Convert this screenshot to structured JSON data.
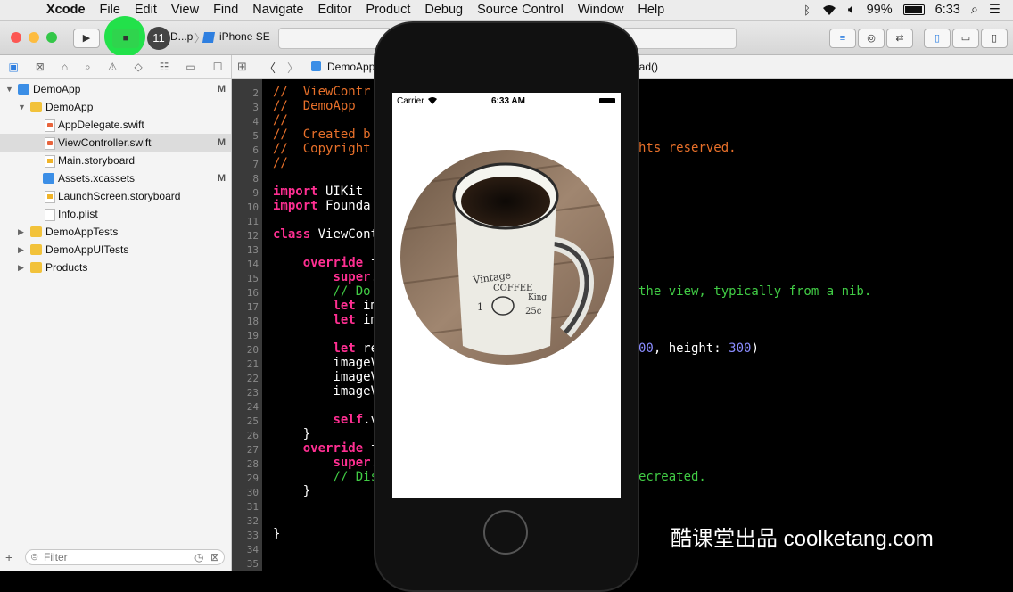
{
  "menubar": {
    "apple": "",
    "app_name": "Xcode",
    "items": [
      "File",
      "Edit",
      "View",
      "Find",
      "Navigate",
      "Editor",
      "Product",
      "Debug",
      "Source Control",
      "Window",
      "Help"
    ],
    "battery": "99%",
    "time": "6:33"
  },
  "toolbar": {
    "badge": "11",
    "scheme": "D...p",
    "device": "iPhone SE"
  },
  "navigator": {
    "rows": [
      {
        "label": "DemoApp",
        "type": "project",
        "m": "M"
      },
      {
        "label": "DemoApp",
        "type": "folder",
        "m": ""
      },
      {
        "label": "AppDelegate.swift",
        "type": "swift",
        "m": ""
      },
      {
        "label": "ViewController.swift",
        "type": "swift",
        "m": "M"
      },
      {
        "label": "Main.storyboard",
        "type": "storyboard",
        "m": ""
      },
      {
        "label": "Assets.xcassets",
        "type": "assets",
        "m": "M"
      },
      {
        "label": "LaunchScreen.storyboard",
        "type": "storyboard",
        "m": ""
      },
      {
        "label": "Info.plist",
        "type": "plist",
        "m": ""
      },
      {
        "label": "DemoAppTests",
        "type": "folder",
        "m": ""
      },
      {
        "label": "DemoAppUITests",
        "type": "folder",
        "m": ""
      },
      {
        "label": "Products",
        "type": "folder",
        "m": ""
      }
    ],
    "filter_placeholder": "Filter"
  },
  "jumpbar": {
    "file": "DemoApp",
    "symbol": "oad()"
  },
  "editor": {
    "lines": [
      {
        "n": "2",
        "t": "//  ViewContr",
        "c": "cmt"
      },
      {
        "n": "3",
        "t": "//  DemoApp",
        "c": "cmt"
      },
      {
        "n": "4",
        "t": "//",
        "c": "cmt"
      },
      {
        "n": "5",
        "t": "//  Created b",
        "c": "cmt"
      },
      {
        "n": "6",
        "t": "//  Copyright",
        "c": "cmt"
      },
      {
        "n": "7",
        "t": "//",
        "c": "cmt"
      },
      {
        "n": "8",
        "t": "",
        "c": ""
      },
      {
        "n": "9",
        "t": "import UIKit",
        "c": "imp"
      },
      {
        "n": "10",
        "t": "import Founda",
        "c": "imp"
      },
      {
        "n": "11",
        "t": "",
        "c": ""
      },
      {
        "n": "12",
        "t": "class ViewCont",
        "c": "cls"
      },
      {
        "n": "13",
        "t": "",
        "c": ""
      },
      {
        "n": "14",
        "t": "    override f",
        "c": "ovr"
      },
      {
        "n": "15",
        "t": "        super.",
        "c": "sup"
      },
      {
        "n": "16",
        "t": "        // Do",
        "c": "cmtg"
      },
      {
        "n": "17",
        "t": "        let im",
        "c": "let"
      },
      {
        "n": "18",
        "t": "        let im",
        "c": "let"
      },
      {
        "n": "19",
        "t": "",
        "c": ""
      },
      {
        "n": "20",
        "t": "        let re",
        "c": "let"
      },
      {
        "n": "21",
        "t": "        imageV",
        "c": ""
      },
      {
        "n": "22",
        "t": "        imageV",
        "c": ""
      },
      {
        "n": "23",
        "t": "        imageV",
        "c": ""
      },
      {
        "n": "24",
        "t": "",
        "c": ""
      },
      {
        "n": "25",
        "t": "        self.v",
        "c": "self"
      },
      {
        "n": "26",
        "t": "    }",
        "c": ""
      },
      {
        "n": "27",
        "t": "    override f",
        "c": "ovr"
      },
      {
        "n": "28",
        "t": "        super.",
        "c": "sup"
      },
      {
        "n": "29",
        "t": "        // Dis",
        "c": "cmtg"
      },
      {
        "n": "30",
        "t": "    }",
        "c": ""
      },
      {
        "n": "31",
        "t": "",
        "c": ""
      },
      {
        "n": "32",
        "t": "",
        "c": ""
      },
      {
        "n": "33",
        "t": "}",
        "c": ""
      },
      {
        "n": "34",
        "t": "",
        "c": ""
      },
      {
        "n": "35",
        "t": "",
        "c": ""
      }
    ],
    "right_fragments": {
      "l6": "hts reserved.",
      "l16": "the view, typically from a nib.",
      "l20_a": "00",
      "l20_b": ", height: ",
      "l20_c": "300",
      "l20_d": ")",
      "l29": "ecreated."
    }
  },
  "phone": {
    "carrier": "Carrier",
    "time": "6:33 AM",
    "mug_text_1": "Vintage",
    "mug_text_2": "COFFEE",
    "mug_text_3": "King",
    "mug_text_4": "1",
    "mug_text_5": "25c"
  },
  "watermark": "酷课堂出品 coolketang.com",
  "colors": {
    "comment": "#e8702a",
    "comment_green": "#41cc45",
    "keyword": "#ff2f92",
    "number": "#8a8cff",
    "run_highlight": "#22e14a"
  }
}
